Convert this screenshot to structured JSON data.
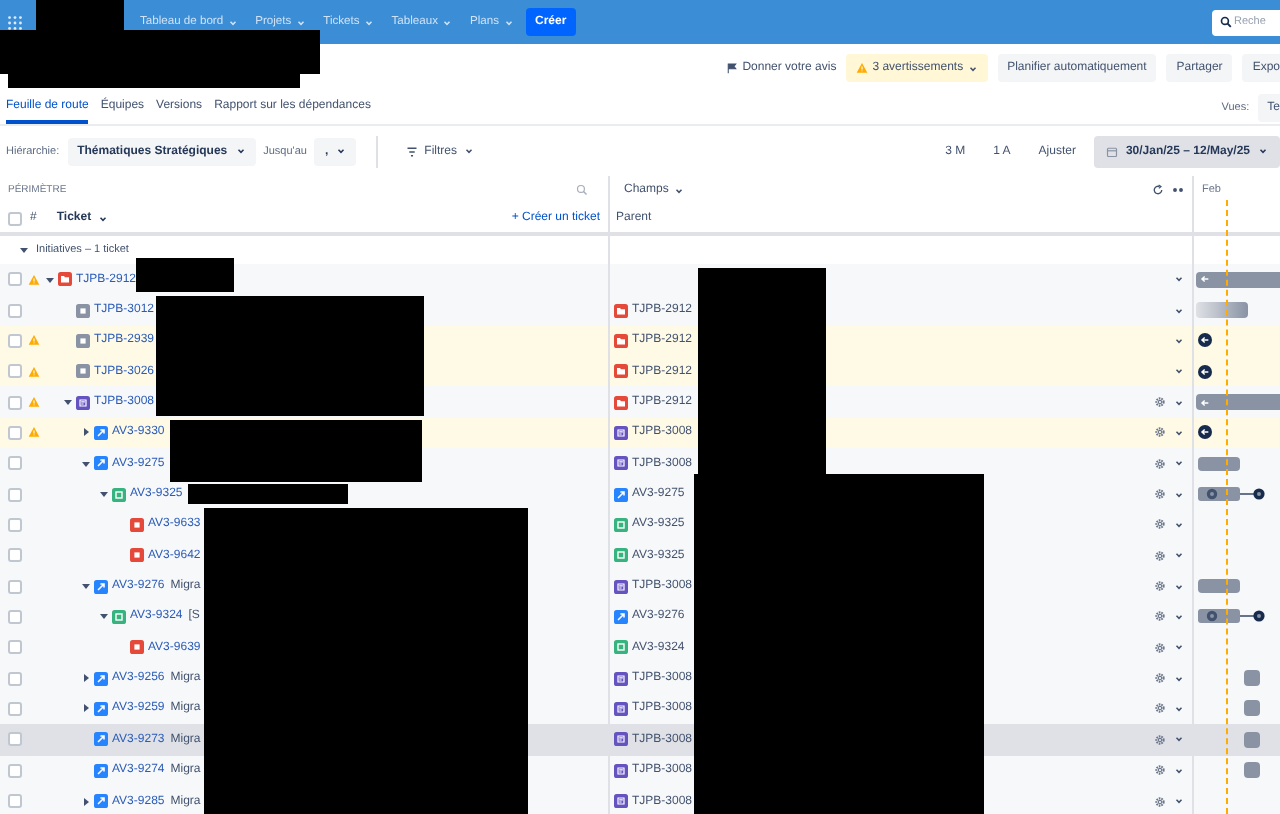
{
  "top_nav": {
    "menus": [
      "Tableau de bord",
      "Projets",
      "Tickets",
      "Tableaux",
      "Plans"
    ],
    "create": "Créer",
    "search": {
      "placeholder": "Reche"
    }
  },
  "actions": {
    "feedback": "Donner votre avis",
    "warnings": "3 avertissements",
    "buttons": [
      "Planifier automatiquement",
      "Partager",
      "Expo"
    ]
  },
  "tabs": [
    {
      "label": "Feuille de route",
      "selected": true
    },
    {
      "label": "Équipes",
      "selected": false
    },
    {
      "label": "Versions",
      "selected": false
    },
    {
      "label": "Rapport sur les dépendances",
      "selected": false
    }
  ],
  "views": {
    "label": "Vues:",
    "value": "Te"
  },
  "toolbar": {
    "hierarchy_label": "Hiérarchie:",
    "hierarchy_from": "Thématiques Stratégiques",
    "until_label": "Jusqu'au",
    "hierarchy_to": ",",
    "filters": "Filtres",
    "zoom_options": [
      "3 M",
      "1 A",
      "Ajuster"
    ],
    "date_range": "30/Jan/25 – 12/May/25"
  },
  "roadmap": {
    "scope_heading": "PÉRIMÈTRE",
    "all_checked": false,
    "number_heading": "#",
    "ticket_heading": "Ticket",
    "create_ticket": "+ Créer un ticket",
    "fields_heading": "Champs",
    "parent_heading": "Parent",
    "timeline_month": "Feb",
    "group": {
      "label": "Initiatives – 1 ticket",
      "expanded": true
    },
    "issues": [
      {
        "key": "TJPB-2912",
        "kind": "initiative",
        "checked": false,
        "warning": true,
        "tinted": false,
        "selected": false,
        "expanded": true,
        "gear": false,
        "bar": {
          "kind": "arrow"
        },
        "children": [
          {
            "key": "TJPB-3012",
            "kind": "theme",
            "checked": false,
            "warning": false,
            "tinted": false,
            "selected": false,
            "gear": false,
            "bar": {
              "kind": "gradient"
            },
            "parent": {
              "key": "TJPB-2912",
              "kind": "initiative"
            }
          },
          {
            "key": "TJPB-2939",
            "kind": "theme",
            "checked": false,
            "warning": true,
            "tinted": true,
            "selected": false,
            "gear": false,
            "bar": {
              "kind": "offscreen"
            },
            "parent": {
              "key": "TJPB-2912",
              "kind": "initiative"
            }
          },
          {
            "key": "TJPB-3026",
            "kind": "theme",
            "checked": false,
            "warning": true,
            "tinted": true,
            "selected": false,
            "gear": false,
            "bar": {
              "kind": "offscreen"
            },
            "parent": {
              "key": "TJPB-2912",
              "kind": "initiative"
            }
          },
          {
            "key": "TJPB-3008",
            "kind": "epic",
            "checked": false,
            "warning": true,
            "tinted": false,
            "selected": false,
            "expanded": true,
            "gear": true,
            "bar": {
              "kind": "arrow"
            },
            "parent": {
              "key": "TJPB-2912",
              "kind": "initiative"
            },
            "children": [
              {
                "key": "AV3-9330",
                "kind": "feature",
                "checked": false,
                "warning": true,
                "tinted": true,
                "selected": false,
                "expanded": false,
                "gear": true,
                "bar": {
                  "kind": "offscreen"
                },
                "parent": {
                  "key": "TJPB-3008",
                  "kind": "epic"
                }
              },
              {
                "key": "AV3-9275",
                "kind": "feature",
                "checked": false,
                "warning": false,
                "tinted": false,
                "selected": false,
                "expanded": true,
                "gear": true,
                "bar": {
                  "kind": "box"
                },
                "parent": {
                  "key": "TJPB-3008",
                  "kind": "epic"
                },
                "children": [
                  {
                    "key": "AV3-9325",
                    "kind": "story",
                    "checked": false,
                    "warning": false,
                    "tinted": false,
                    "selected": false,
                    "expanded": true,
                    "gear": true,
                    "bar": {
                      "kind": "linked"
                    },
                    "parent": {
                      "key": "AV3-9275",
                      "kind": "feature"
                    },
                    "children": [
                      {
                        "key": "AV3-9633",
                        "kind": "defect",
                        "checked": false,
                        "warning": false,
                        "tinted": false,
                        "selected": false,
                        "gear": true,
                        "parent": {
                          "key": "AV3-9325",
                          "kind": "story"
                        }
                      },
                      {
                        "key": "AV3-9642",
                        "kind": "defect",
                        "checked": false,
                        "warning": false,
                        "tinted": false,
                        "selected": false,
                        "gear": true,
                        "parent": {
                          "key": "AV3-9325",
                          "kind": "story"
                        }
                      }
                    ]
                  }
                ]
              },
              {
                "key": "AV3-9276",
                "title": "Migra",
                "kind": "feature",
                "checked": false,
                "warning": false,
                "tinted": false,
                "selected": false,
                "expanded": true,
                "gear": true,
                "bar": {
                  "kind": "box"
                },
                "parent": {
                  "key": "TJPB-3008",
                  "kind": "epic"
                },
                "children": [
                  {
                    "key": "AV3-9324",
                    "title": "[S",
                    "kind": "story",
                    "checked": false,
                    "warning": false,
                    "tinted": false,
                    "selected": false,
                    "expanded": true,
                    "gear": true,
                    "bar": {
                      "kind": "linked"
                    },
                    "parent": {
                      "key": "AV3-9276",
                      "kind": "feature"
                    },
                    "children": [
                      {
                        "key": "AV3-9639",
                        "kind": "defect",
                        "checked": false,
                        "warning": false,
                        "tinted": false,
                        "selected": false,
                        "gear": true,
                        "parent": {
                          "key": "AV3-9324",
                          "kind": "story"
                        }
                      }
                    ]
                  }
                ]
              },
              {
                "key": "AV3-9256",
                "title": "Migra",
                "kind": "feature",
                "checked": false,
                "warning": false,
                "tinted": false,
                "selected": false,
                "expanded": false,
                "gear": true,
                "bar": {
                  "kind": "square"
                },
                "parent": {
                  "key": "TJPB-3008",
                  "kind": "epic"
                }
              },
              {
                "key": "AV3-9259",
                "title": "Migra",
                "kind": "feature",
                "checked": false,
                "warning": false,
                "tinted": false,
                "selected": false,
                "expanded": false,
                "gear": true,
                "bar": {
                  "kind": "square"
                },
                "parent": {
                  "key": "TJPB-3008",
                  "kind": "epic"
                }
              },
              {
                "key": "AV3-9273",
                "title": "Migra",
                "kind": "feature",
                "checked": false,
                "warning": false,
                "tinted": false,
                "selected": true,
                "gear": true,
                "bar": {
                  "kind": "square"
                },
                "parent": {
                  "key": "TJPB-3008",
                  "kind": "epic"
                }
              },
              {
                "key": "AV3-9274",
                "title": "Migra",
                "kind": "feature",
                "checked": false,
                "warning": false,
                "tinted": false,
                "selected": false,
                "gear": true,
                "bar": {
                  "kind": "square"
                },
                "parent": {
                  "key": "TJPB-3008",
                  "kind": "epic"
                }
              },
              {
                "key": "AV3-9285",
                "title": "Migra",
                "kind": "feature",
                "checked": false,
                "warning": false,
                "tinted": false,
                "selected": false,
                "expanded": false,
                "gear": true,
                "parent": {
                  "key": "TJPB-3008",
                  "kind": "epic"
                }
              }
            ]
          }
        ]
      }
    ]
  }
}
